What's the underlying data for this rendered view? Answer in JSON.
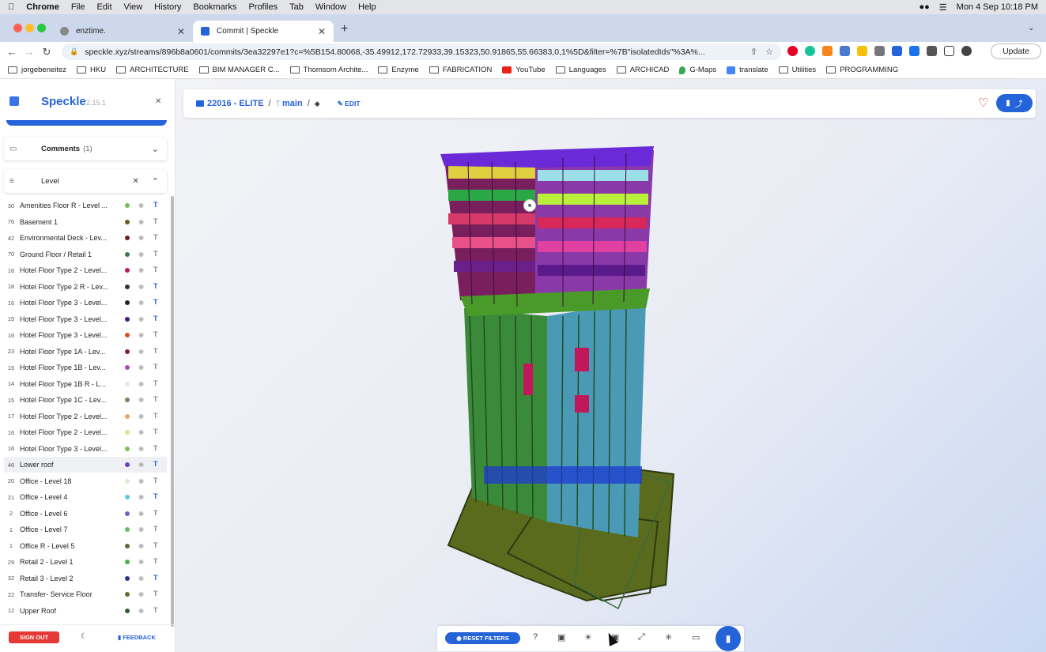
{
  "menubar": {
    "items": [
      "Chrome",
      "File",
      "Edit",
      "View",
      "History",
      "Bookmarks",
      "Profiles",
      "Tab",
      "Window",
      "Help"
    ],
    "datetime": "Mon 4 Sep  10:18 PM"
  },
  "tabs": [
    {
      "title": "enztime."
    },
    {
      "title": "Commit | Speckle"
    }
  ],
  "address": {
    "url": "speckle.xyz/streams/896b8a0601/commits/3ea32297e1?c=%5B154.80068,-35.49912,172.72933,39.15323,50.91865,55.66383,0,1%5D&filter=%7B\"isolatedIds\"%3A%..."
  },
  "update_label": "Update",
  "bookmarks": [
    "jorgebeneitez",
    "HKU",
    "ARCHITECTURE",
    "BIM MANAGER C...",
    "Thomsom Archite...",
    "Enzyme",
    "FABRICATION",
    "YouTube",
    "Languages",
    "ARCHICAD",
    "G-Maps",
    "translate",
    "Utilities",
    "PROGRAMMING"
  ],
  "sidebar": {
    "brand": "Speckle",
    "version": "2.15.1",
    "comments_label": "Comments",
    "comments_count": "(1)",
    "filter_label": "Level",
    "filters": [
      {
        "count": "30",
        "name": "Amenities Floor R - Level ...",
        "color": "#6fbf5a",
        "active": true
      },
      {
        "count": "76",
        "name": "Basement 1",
        "color": "#6b5a1e",
        "active": false
      },
      {
        "count": "42",
        "name": "Environmental Deck - Lev...",
        "color": "#6b1f1f",
        "active": false
      },
      {
        "count": "70",
        "name": "Ground Floor / Retail 1",
        "color": "#3a7a4f",
        "active": false
      },
      {
        "count": "16",
        "name": "Hotel Floor Type 2 - Level...",
        "color": "#c2185b",
        "active": false
      },
      {
        "count": "18",
        "name": "Hotel Floor Type 2 R - Lev...",
        "color": "#333333",
        "active": true
      },
      {
        "count": "16",
        "name": "Hotel Floor Type 3 - Level...",
        "color": "#222222",
        "active": true
      },
      {
        "count": "15",
        "name": "Hotel Floor Type 3 - Level...",
        "color": "#4a148c",
        "active": true
      },
      {
        "count": "16",
        "name": "Hotel Floor Type 3 - Level...",
        "color": "#e64a19",
        "active": false
      },
      {
        "count": "23",
        "name": "Hotel Floor Type 1A - Lev...",
        "color": "#8b1a3a",
        "active": false
      },
      {
        "count": "15",
        "name": "Hotel Floor Type 1B - Lev...",
        "color": "#ab47bc",
        "active": false
      },
      {
        "count": "14",
        "name": "Hotel Floor Type 1B R - L...",
        "color": "#d9ecef",
        "active": false
      },
      {
        "count": "15",
        "name": "Hotel Floor Type 1C - Lev...",
        "color": "#8c7a5a",
        "active": false
      },
      {
        "count": "17",
        "name": "Hotel Floor Type 2 - Level...",
        "color": "#f0a35e",
        "active": false
      },
      {
        "count": "16",
        "name": "Hotel Floor Type 2 - Level...",
        "color": "#e0e08a",
        "active": false
      },
      {
        "count": "16",
        "name": "Hotel Floor Type 3 - Level...",
        "color": "#7cc24e",
        "active": false
      },
      {
        "count": "46",
        "name": "Lower roof",
        "color": "#6a3fc9",
        "active": true
      },
      {
        "count": "20",
        "name": "Office - Level 18",
        "color": "#d7efd0",
        "active": false
      },
      {
        "count": "21",
        "name": "Office - Level 4",
        "color": "#5bc5e6",
        "active": true
      },
      {
        "count": "2",
        "name": "Office - Level 6",
        "color": "#7a5bc9",
        "active": false
      },
      {
        "count": "1",
        "name": "Office - Level 7",
        "color": "#66bb6a",
        "active": false
      },
      {
        "count": "1",
        "name": "Office R - Level 5",
        "color": "#5a6b3a",
        "active": false
      },
      {
        "count": "29",
        "name": "Retail 2 - Level 1",
        "color": "#4caf50",
        "active": false
      },
      {
        "count": "32",
        "name": "Retail 3 - Level 2",
        "color": "#283593",
        "active": true
      },
      {
        "count": "22",
        "name": "Transfer- Service Floor",
        "color": "#6b6b2a",
        "active": false
      },
      {
        "count": "12",
        "name": "Upper Roof",
        "color": "#2e5e2e",
        "active": false
      }
    ],
    "signout_label": "SIGN OUT",
    "feedback_label": "FEEDBACK"
  },
  "viewer": {
    "stream": "22016 - ELITE",
    "branch": "main",
    "edit_label": "EDIT",
    "reset_filters_label": "RESET FILTERS"
  },
  "colors": {
    "accent": "#2563d9",
    "danger": "#e53935"
  }
}
